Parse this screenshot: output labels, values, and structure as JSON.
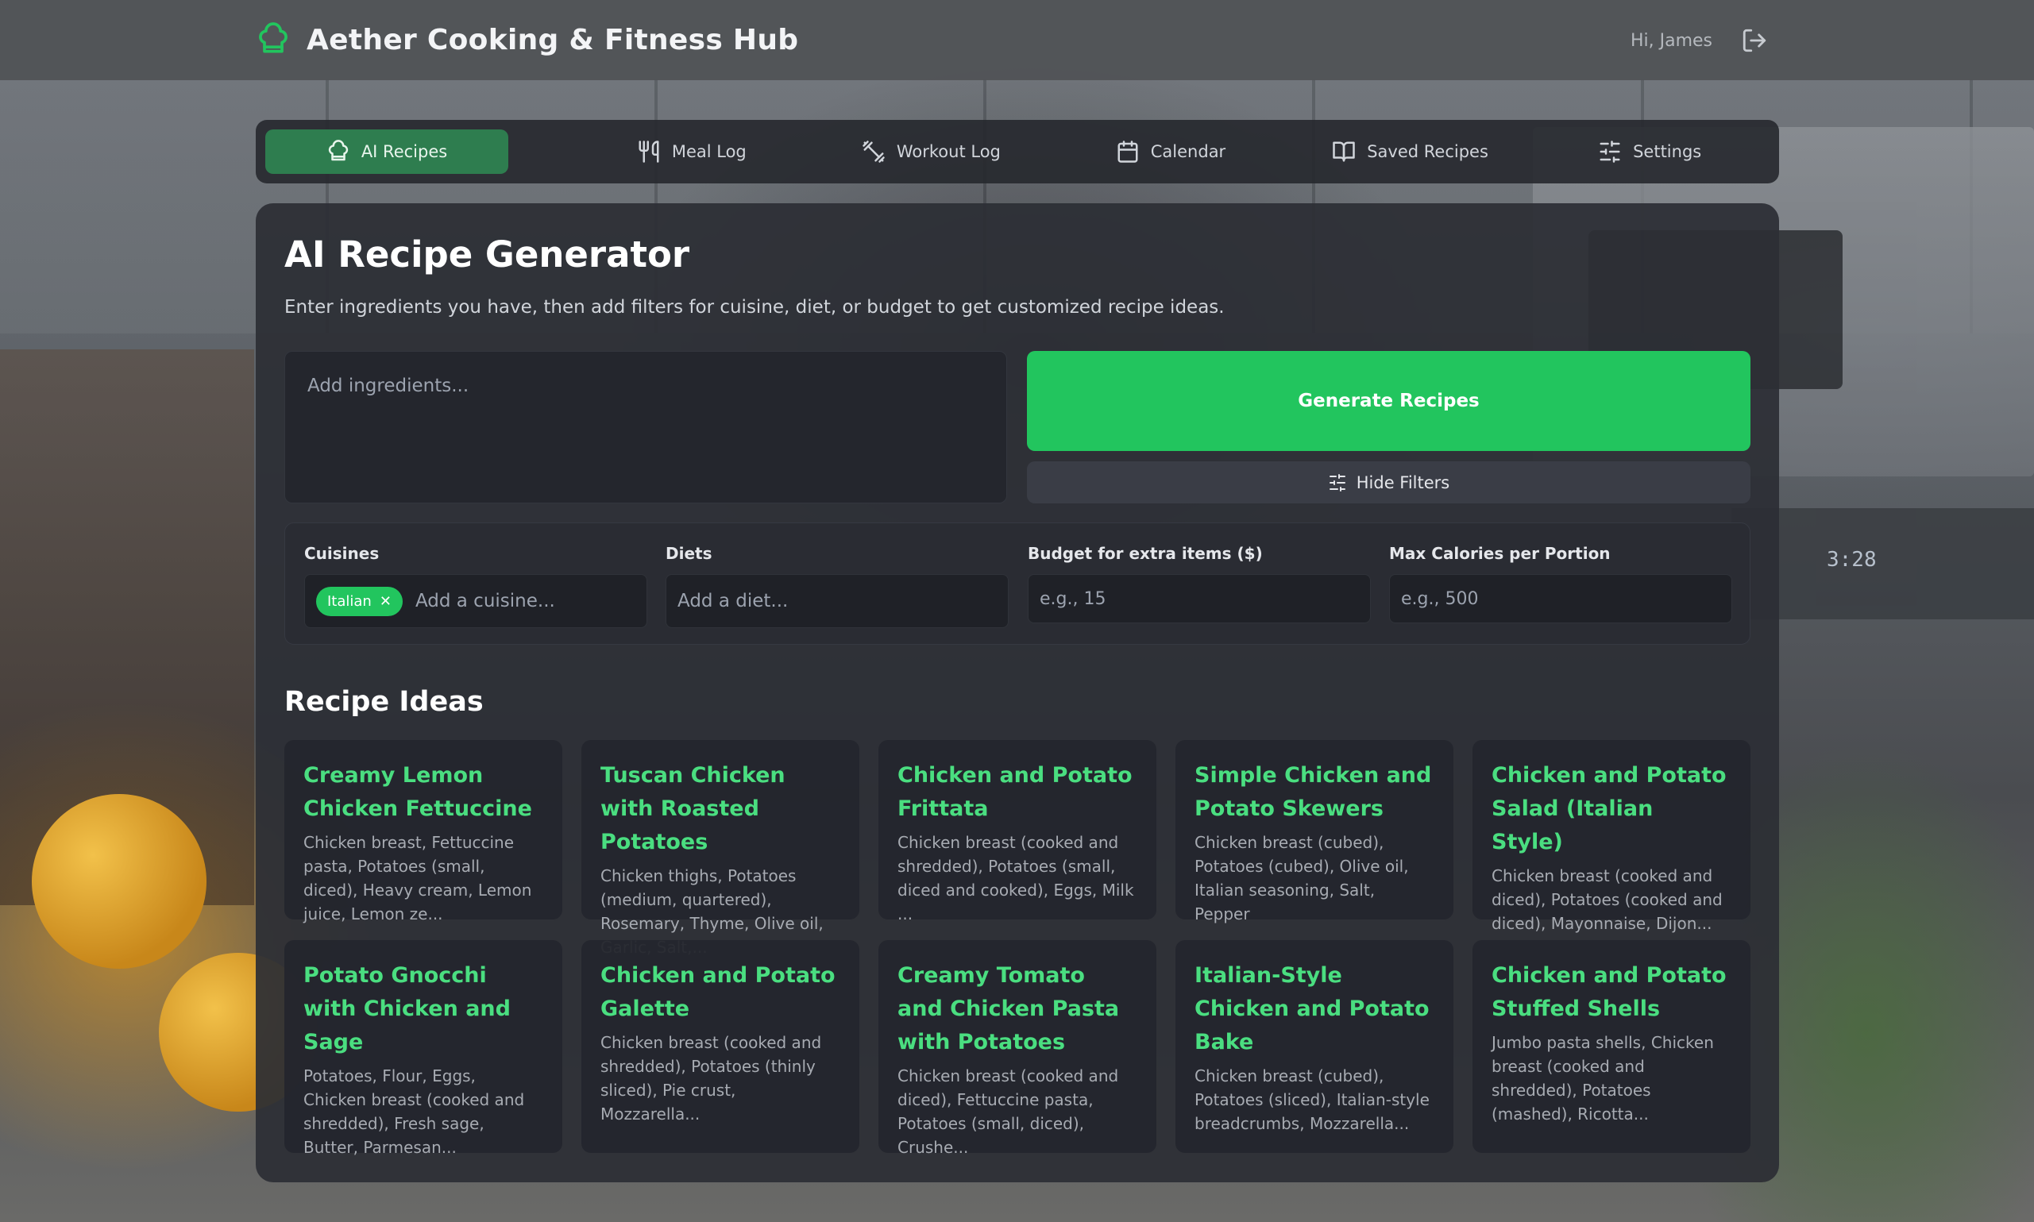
{
  "header": {
    "app_title": "Aether Cooking & Fitness Hub",
    "greeting": "Hi, James",
    "logo_icon": "chef-hat-icon",
    "logout_icon": "logout-icon"
  },
  "nav": {
    "tabs": [
      {
        "label": "AI Recipes",
        "icon": "chef-hat-icon",
        "active": true
      },
      {
        "label": "Meal Log",
        "icon": "utensils-icon",
        "active": false
      },
      {
        "label": "Workout Log",
        "icon": "dumbbell-icon",
        "active": false
      },
      {
        "label": "Calendar",
        "icon": "calendar-icon",
        "active": false
      },
      {
        "label": "Saved Recipes",
        "icon": "book-icon",
        "active": false
      },
      {
        "label": "Settings",
        "icon": "sliders-icon",
        "active": false
      }
    ]
  },
  "generator": {
    "title": "AI Recipe Generator",
    "subtitle": "Enter ingredients you have, then add filters for cuisine, diet, or budget to get customized recipe ideas.",
    "ingredients_placeholder": "Add ingredients...",
    "generate_label": "Generate Recipes",
    "hide_filters_label": "Hide Filters"
  },
  "filters": {
    "cuisines": {
      "label": "Cuisines",
      "selected_chip": "Italian",
      "placeholder": "Add a cuisine..."
    },
    "diets": {
      "label": "Diets",
      "placeholder": "Add a diet..."
    },
    "budget": {
      "label": "Budget for extra items ($)",
      "placeholder": "e.g., 15"
    },
    "calories": {
      "label": "Max Calories per Portion",
      "placeholder": "e.g., 500"
    }
  },
  "recipes": {
    "title": "Recipe Ideas",
    "items": [
      {
        "title": "Creamy Lemon Chicken Fettuccine",
        "desc": "Chicken breast, Fettuccine pasta, Potatoes (small, diced), Heavy cream, Lemon juice, Lemon ze..."
      },
      {
        "title": "Tuscan Chicken with Roasted Potatoes",
        "desc": "Chicken thighs, Potatoes (medium, quartered), Rosemary, Thyme, Olive oil, Garlic, Salt,..."
      },
      {
        "title": "Chicken and Potato Frittata",
        "desc": "Chicken breast (cooked and shredded), Potatoes (small, diced and cooked), Eggs, Milk ..."
      },
      {
        "title": "Simple Chicken and Potato Skewers",
        "desc": "Chicken breast (cubed), Potatoes (cubed), Olive oil, Italian seasoning, Salt, Pepper"
      },
      {
        "title": "Chicken and Potato Salad (Italian Style)",
        "desc": "Chicken breast (cooked and diced), Potatoes (cooked and diced), Mayonnaise, Dijon..."
      },
      {
        "title": "Potato Gnocchi with Chicken and Sage",
        "desc": "Potatoes, Flour, Eggs, Chicken breast (cooked and shredded), Fresh sage, Butter, Parmesan..."
      },
      {
        "title": "Chicken and Potato Galette",
        "desc": "Chicken breast (cooked and shredded), Potatoes (thinly sliced), Pie crust, Mozzarella..."
      },
      {
        "title": "Creamy Tomato and Chicken Pasta with Potatoes",
        "desc": "Chicken breast (cooked and diced), Fettuccine pasta, Potatoes (small, diced), Crushe..."
      },
      {
        "title": "Italian-Style Chicken and Potato Bake",
        "desc": "Chicken breast (cubed), Potatoes (sliced), Italian-style breadcrumbs, Mozzarella..."
      },
      {
        "title": "Chicken and Potato Stuffed Shells",
        "desc": "Jumbo pasta shells, Chicken breast (cooked and shredded), Potatoes (mashed), Ricotta..."
      }
    ]
  },
  "background": {
    "oven_clock": "3:28"
  },
  "colors": {
    "accent": "#22c55e",
    "accent_text": "#4ade80",
    "active_tab": "#2e7d4f"
  }
}
